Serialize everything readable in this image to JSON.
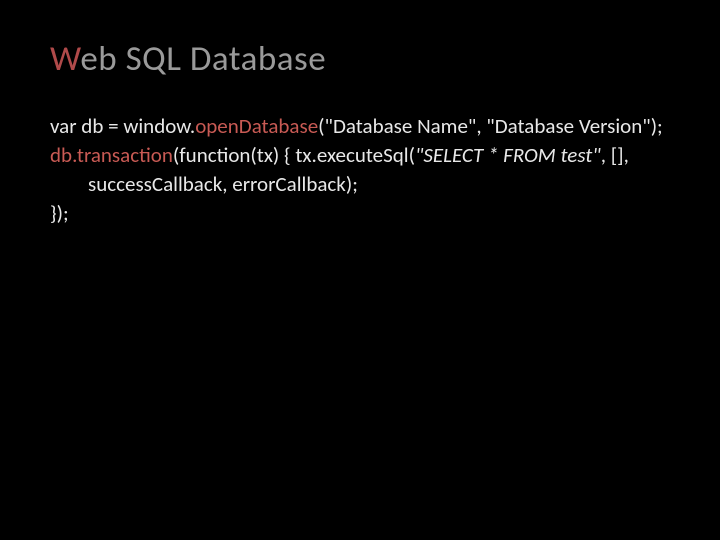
{
  "title": {
    "accent": "W",
    "rest": "eb SQL Database"
  },
  "code": {
    "line1_part1": "var db = window.",
    "line1_hl": "openDatabase",
    "line1_part2": "(\"Database Name\", \"Database Version\");",
    "line2_hl": "db.transaction",
    "line2_part1": "(function(tx) { tx.executeSql(",
    "line2_sql": "\"SELECT * FROM test\"",
    "line2_part2": ", [], successCallback, errorCallback);",
    "line3": "});"
  }
}
